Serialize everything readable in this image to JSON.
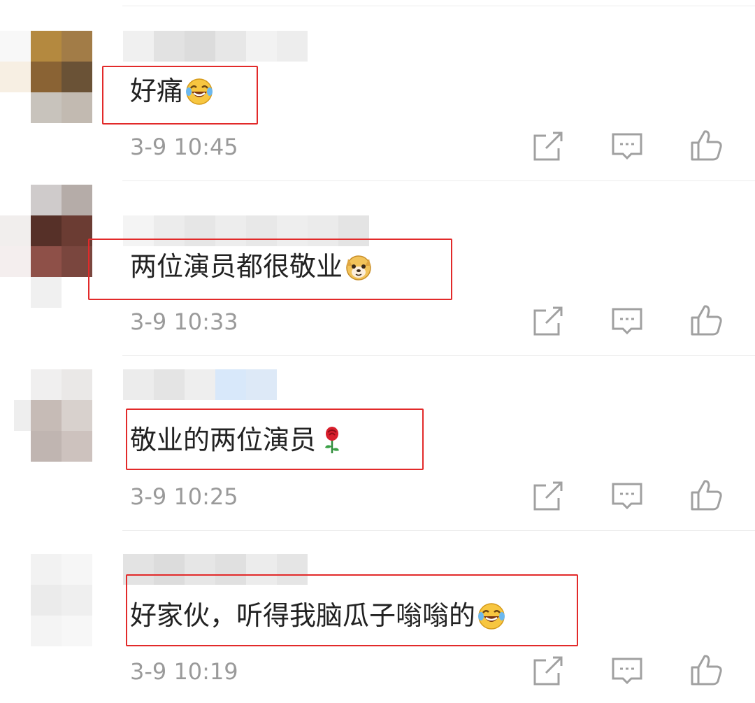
{
  "comments": [
    {
      "text": "好痛",
      "emoji": "laughing-tears-emoji",
      "time": "3-9 10:45"
    },
    {
      "text": "两位演员都很敬业",
      "emoji": "doge-emoji",
      "time": "3-9 10:33"
    },
    {
      "text": "敬业的两位演员",
      "emoji": "rose-emoji",
      "time": "3-9 10:25"
    },
    {
      "text": "好家伙，听得我脑瓜子嗡嗡的",
      "emoji": "laughing-tears-emoji",
      "time": "3-9 10:19"
    }
  ],
  "icons": {
    "share": "share-icon",
    "reply": "reply-comment-icon",
    "like": "thumbs-up-icon"
  },
  "colors": {
    "highlight_box": "#e22a2a",
    "timestamp": "#9a9a9a",
    "icon": "#a0a0a0",
    "text": "#222222"
  }
}
